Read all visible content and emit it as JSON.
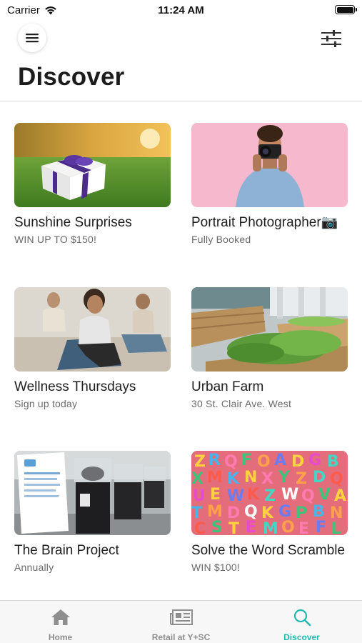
{
  "status_bar": {
    "carrier": "Carrier",
    "time": "11:24 AM"
  },
  "header": {
    "title": "Discover",
    "menu_icon": "menu-icon",
    "filter_icon": "sliders-icon"
  },
  "cards": [
    {
      "title": "Sunshine Surprises",
      "subtitle": "WIN UP TO $150!"
    },
    {
      "title": "Portrait Photographer📷",
      "subtitle": "Fully Booked"
    },
    {
      "title": "Wellness Thursdays",
      "subtitle": "Sign up today"
    },
    {
      "title": "Urban Farm",
      "subtitle": "30 St. Clair Ave. West"
    },
    {
      "title": "The Brain Project",
      "subtitle": "Annually"
    },
    {
      "title": "Solve the Word Scramble",
      "subtitle": "WIN $100!"
    }
  ],
  "tabs": [
    {
      "label": "Home",
      "icon": "home-icon"
    },
    {
      "label": "Retail at Y+SC",
      "icon": "newspaper-icon"
    },
    {
      "label": "Discover",
      "icon": "search-icon",
      "active": true
    }
  ],
  "colors": {
    "accent": "#22b8b0",
    "inactive": "#8e8e8e"
  }
}
